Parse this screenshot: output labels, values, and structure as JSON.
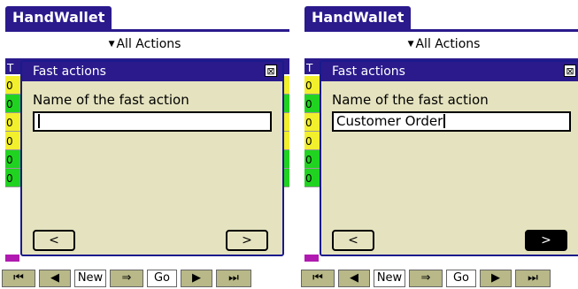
{
  "screens": [
    {
      "app_title": "HandWallet",
      "filter_label": "All Actions",
      "header_text": "T",
      "rows": [
        {
          "text": "0",
          "color": "#f2ef2d"
        },
        {
          "text": "0",
          "color": "#21d321"
        },
        {
          "text": "0",
          "color": "#f2ef2d"
        },
        {
          "text": "0",
          "color": "#f2ef2d"
        },
        {
          "text": "0",
          "color": "#21d321"
        },
        {
          "text": "0",
          "color": "#21d321"
        }
      ],
      "dialog": {
        "title": "Fast actions",
        "close_glyph": "⊠",
        "field_label": "Name of the fast action",
        "field_value": "",
        "prev_label": "<",
        "next_label": ">",
        "next_active": false
      },
      "toolbar": [
        "⏮",
        "◀",
        "New",
        "⇒",
        "Go",
        "▶",
        "⏭"
      ]
    },
    {
      "app_title": "HandWallet",
      "filter_label": "All Actions",
      "header_text": "T",
      "rows": [
        {
          "text": "0",
          "color": "#f2ef2d"
        },
        {
          "text": "0",
          "color": "#21d321"
        },
        {
          "text": "0",
          "color": "#f2ef2d"
        },
        {
          "text": "0",
          "color": "#f2ef2d"
        },
        {
          "text": "0",
          "color": "#21d321"
        },
        {
          "text": "0",
          "color": "#21d321"
        }
      ],
      "dialog": {
        "title": "Fast actions",
        "close_glyph": "⊠",
        "field_label": "Name of the fast action",
        "field_value": "Customer Order",
        "prev_label": "<",
        "next_label": ">",
        "next_active": true
      },
      "toolbar": [
        "⏮",
        "◀",
        "New",
        "⇒",
        "Go",
        "▶",
        "⏭"
      ]
    }
  ]
}
